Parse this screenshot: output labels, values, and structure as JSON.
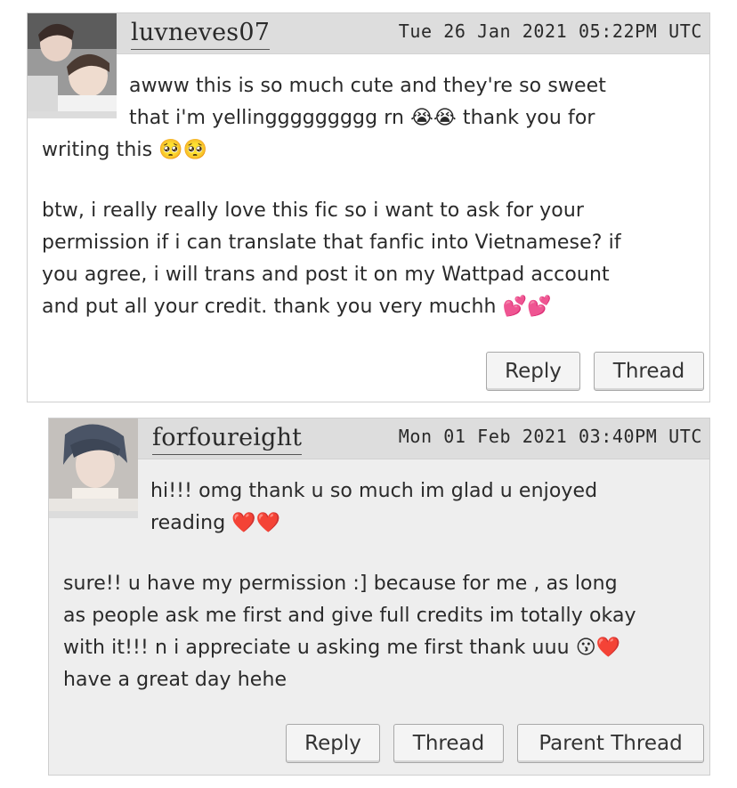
{
  "comments": [
    {
      "username": "luvneves07",
      "datetime": "Tue 26 Jan 2021 05:22PM UTC",
      "lines": [
        "awww this is so much cute and they're so sweet",
        "that i'm yellinggggggggg rn 😭😭 thank you for",
        "writing this 🥺🥺"
      ],
      "paragraph2": [
        "btw, i really really love this fic so i want to ask for your",
        "permission if i can translate that fanfic into Vietnamese? if",
        "you agree, i will trans and post it on my Wattpad account",
        "and put all your credit. thank you very muchh 💕💕"
      ],
      "buttons": [
        "Reply",
        "Thread"
      ]
    },
    {
      "username": "forfoureight",
      "datetime": "Mon 01 Feb 2021 03:40PM UTC",
      "lines": [
        "hi!!! omg thank u so much im glad u enjoyed",
        "reading ❤️❤️"
      ],
      "paragraph2": [
        "sure!! u have my permission :] because for me , as long",
        "as people ask me first and give full credits im totally okay",
        "with it!!! n i appreciate u asking me first thank uuu 😗❤️",
        "have a great day hehe"
      ],
      "buttons": [
        "Reply",
        "Thread",
        "Parent Thread"
      ]
    }
  ]
}
